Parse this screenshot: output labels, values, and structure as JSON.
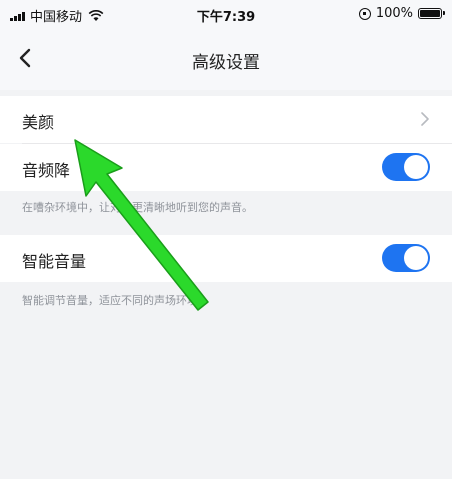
{
  "status_bar": {
    "carrier": "中国移动",
    "time": "下午7:39",
    "battery": "100%",
    "icons": [
      "signal-icon",
      "wifi-icon",
      "orientation-lock-icon",
      "battery-icon"
    ]
  },
  "nav": {
    "title": "高级设置",
    "back_icon": "chevron-left-icon"
  },
  "settings": [
    {
      "label": "美颜",
      "control": "chevron-right-icon"
    },
    {
      "label": "音频降",
      "control": "toggle",
      "enabled": true,
      "hint": "在嘈杂环境中，让对方更清晰地听到您的声音。"
    },
    {
      "label": "智能音量",
      "control": "toggle",
      "enabled": true,
      "hint": "智能调节音量，适应不同的声场环境。"
    }
  ],
  "colors": {
    "accent": "#1e74f1",
    "annotation_arrow": "#2bd92b"
  }
}
